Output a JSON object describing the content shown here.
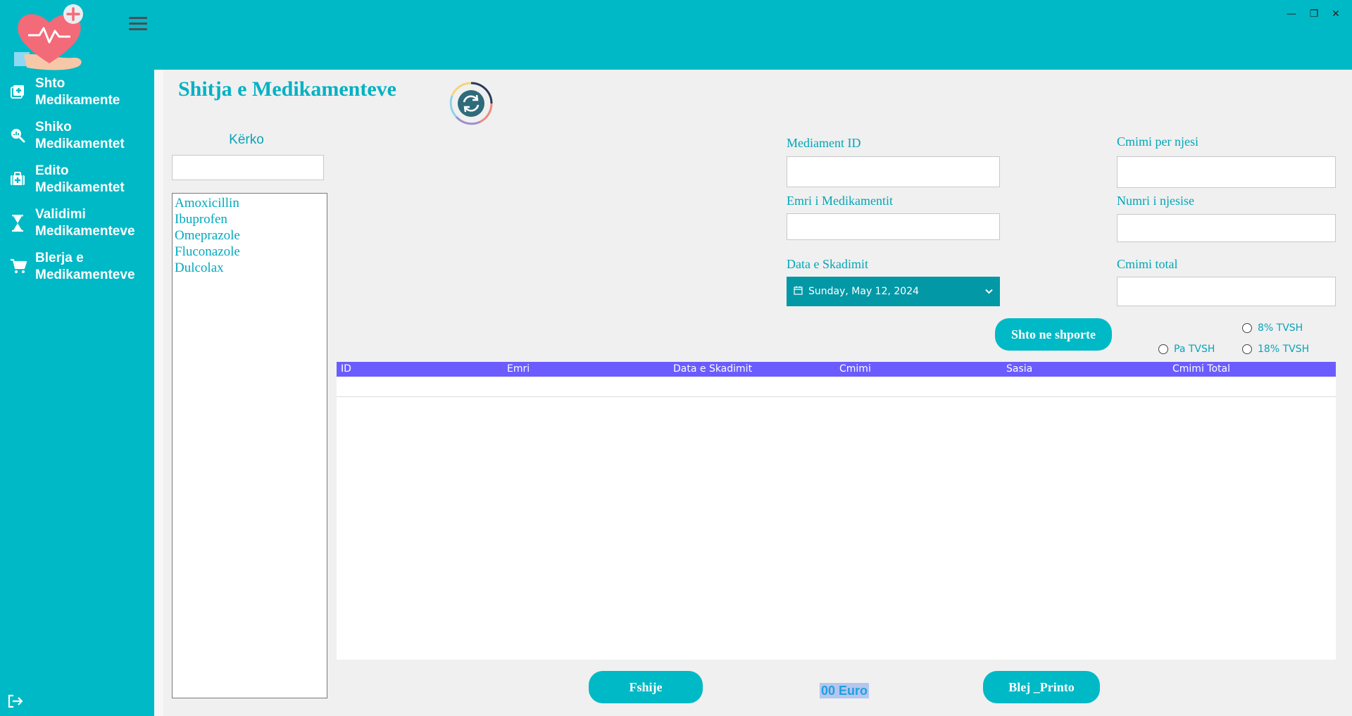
{
  "window": {
    "minimize": "—",
    "maximize": "❐",
    "close": "✕"
  },
  "sidebar": {
    "items": [
      {
        "label1": "Shto",
        "label2": "Medikamente",
        "icon": "add-medicine-icon"
      },
      {
        "label1": "Shiko",
        "label2": "Medikamentet",
        "icon": "search-chart-icon"
      },
      {
        "label1": "Edito",
        "label2": "Medikamentet",
        "icon": "medical-kit-icon"
      },
      {
        "label1": "Validimi",
        "label2": "Medikamenteve",
        "icon": "hourglass-icon"
      },
      {
        "label1": "Blerja e",
        "label2": "Medikamenteve",
        "icon": "cart-icon"
      }
    ]
  },
  "page": {
    "title": "Shitja e Medikamenteve"
  },
  "search": {
    "label": "Kërko",
    "value": ""
  },
  "medicines": [
    "Amoxicillin",
    "Ibuprofen",
    "Omeprazole",
    "Fluconazole",
    "Dulcolax"
  ],
  "form": {
    "id_label": "Mediament ID",
    "name_label": "Emri i Medikamentit",
    "expiry_label": "Data e Skadimit",
    "expiry_value": "Sunday,   May   12, 2024",
    "unit_price_label": "Cmimi per njesi",
    "units_label": "Numri i njesise",
    "total_label": "Cmimi total"
  },
  "buttons": {
    "add_to_cart": "Shto ne shporte",
    "delete": "Fshije",
    "buy_print": "Blej _Printo"
  },
  "vat": {
    "opt_8": "8% TVSH",
    "opt_none": "Pa TVSH",
    "opt_18": "18% TVSH"
  },
  "table": {
    "columns": [
      "ID",
      "Emri",
      "Data e Skadimit",
      "Cmimi",
      "Sasia",
      "Cmimi Total"
    ]
  },
  "total": {
    "amount": "00 Euro"
  },
  "colors": {
    "accent": "#00b9c6",
    "header": "#6b5cff",
    "datepicker": "#0398a6"
  }
}
